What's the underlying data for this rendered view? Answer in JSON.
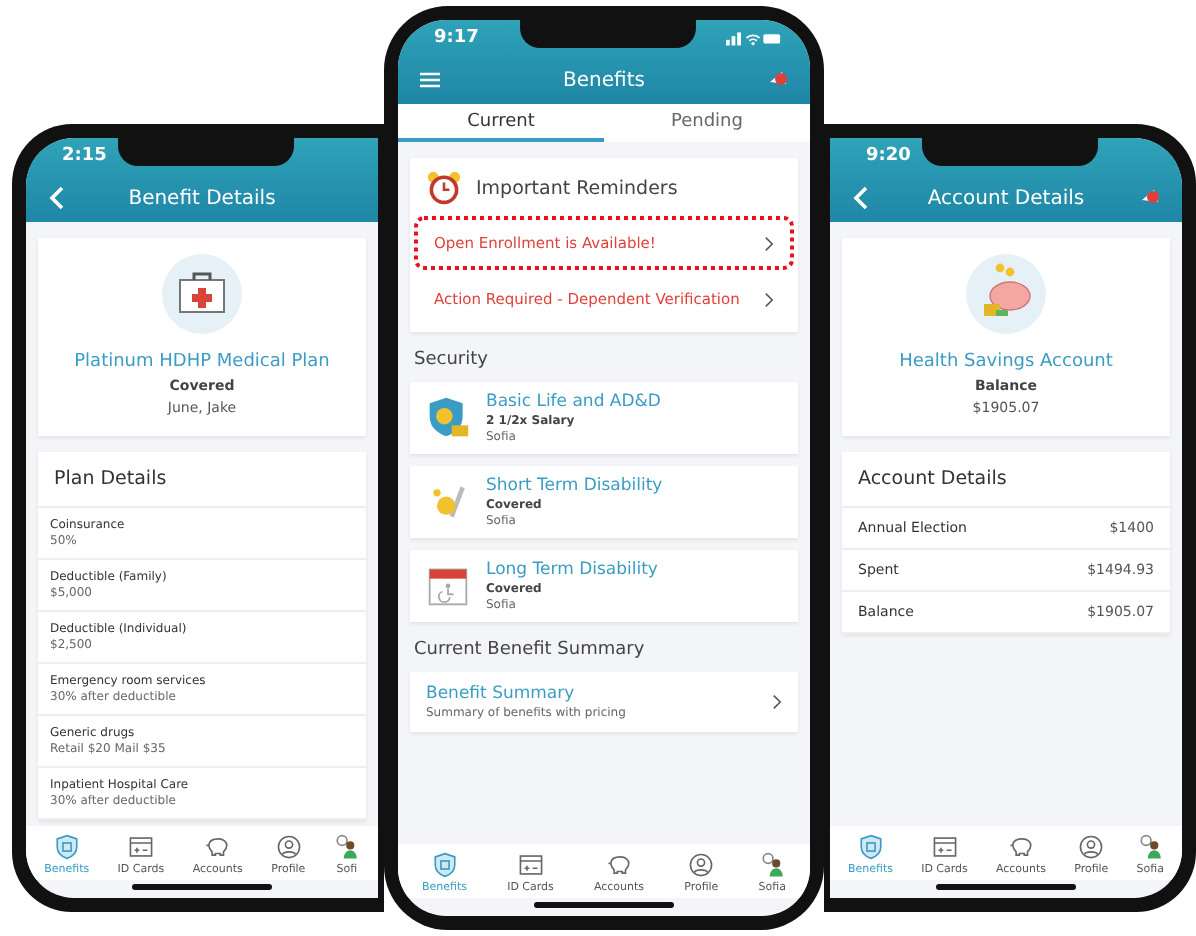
{
  "left_phone": {
    "time": "2:15",
    "title": "Benefit Details",
    "plan": {
      "name": "Platinum HDHP Medical Plan",
      "status": "Covered",
      "members": "June, Jake"
    },
    "section_title": "Plan Details",
    "details": [
      {
        "label": "Coinsurance",
        "value": "50%"
      },
      {
        "label": "Deductible (Family)",
        "value": "$5,000"
      },
      {
        "label": "Deductible (Individual)",
        "value": "$2,500"
      },
      {
        "label": "Emergency room services",
        "value": "30% after deductible"
      },
      {
        "label": "Generic drugs",
        "value": "Retail $20 Mail $35"
      },
      {
        "label": "Inpatient Hospital Care",
        "value": "30% after deductible"
      }
    ],
    "tab_bar": [
      {
        "kind": "shield",
        "label": "Benefits",
        "selected": true
      },
      {
        "kind": "card",
        "label": "ID Cards",
        "selected": false
      },
      {
        "kind": "piggy",
        "label": "Accounts",
        "selected": false
      },
      {
        "kind": "profile",
        "label": "Profile",
        "selected": false
      },
      {
        "kind": "avatar",
        "label": "Sofi",
        "selected": false
      }
    ]
  },
  "center_phone": {
    "time": "9:17",
    "title": "Benefits",
    "tabs": [
      {
        "label": "Current",
        "selected": true
      },
      {
        "label": "Pending",
        "selected": false
      }
    ],
    "reminders_title": "Important Reminders",
    "reminders": [
      {
        "text": "Open Enrollment is Available!",
        "highlighted": true
      },
      {
        "text": "Action Required - Dependent Verification",
        "highlighted": false
      }
    ],
    "section_title": "Security",
    "benefits": [
      {
        "kind": "life",
        "name": "Basic Life and AD&D",
        "status": "2 1/2x Salary",
        "member": "Sofia"
      },
      {
        "kind": "short",
        "name": "Short Term Disability",
        "status": "Covered",
        "member": "Sofia"
      },
      {
        "kind": "long",
        "name": "Long Term Disability",
        "status": "Covered",
        "member": "Sofia"
      }
    ],
    "summary_title": "Current Benefit Summary",
    "summary": {
      "title": "Benefit Summary",
      "subtitle": "Summary of benefits with pricing"
    },
    "tab_bar": [
      {
        "kind": "shield",
        "label": "Benefits",
        "selected": true
      },
      {
        "kind": "card",
        "label": "ID Cards",
        "selected": false
      },
      {
        "kind": "piggy",
        "label": "Accounts",
        "selected": false
      },
      {
        "kind": "profile",
        "label": "Profile",
        "selected": false
      },
      {
        "kind": "avatar",
        "label": "Sofia",
        "selected": false
      }
    ]
  },
  "right_phone": {
    "time": "9:20",
    "title": "Account Details",
    "account": {
      "name": "Health Savings Account",
      "label": "Balance",
      "amount": "$1905.07"
    },
    "section_title": "Account Details",
    "rows": [
      {
        "label": "Annual Election",
        "value": "$1400"
      },
      {
        "label": "Spent",
        "value": "$1494.93"
      },
      {
        "label": "Balance",
        "value": "$1905.07"
      }
    ],
    "tab_bar": [
      {
        "kind": "shield",
        "label": "Benefits",
        "selected": true
      },
      {
        "kind": "card",
        "label": "ID Cards",
        "selected": false
      },
      {
        "kind": "piggy",
        "label": "Accounts",
        "selected": false
      },
      {
        "kind": "profile",
        "label": "Profile",
        "selected": false
      },
      {
        "kind": "avatar",
        "label": "Sofia",
        "selected": false
      }
    ]
  }
}
